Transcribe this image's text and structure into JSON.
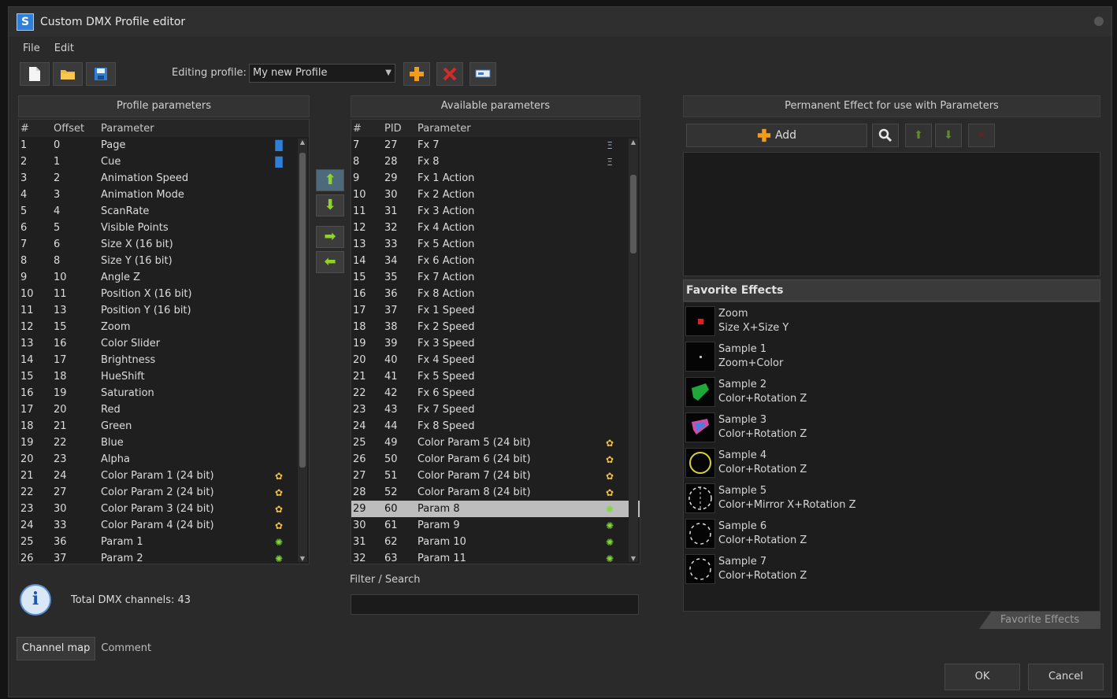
{
  "window": {
    "title": "Custom DMX Profile editor"
  },
  "menu": [
    "File",
    "Edit"
  ],
  "toolbar": {
    "editing_label": "Editing profile:",
    "profile_value": "My new Profile",
    "new_icon": "new-file-icon",
    "open_icon": "open-folder-icon",
    "save_icon": "save-disk-icon",
    "add_icon": "add-plus-icon",
    "delete_icon": "delete-x-icon",
    "rename_icon": "rename-icon"
  },
  "profile_params": {
    "title": "Profile parameters",
    "headers": [
      "#",
      "Offset",
      "Parameter"
    ],
    "rows": [
      [
        "1",
        "0",
        "Page"
      ],
      [
        "2",
        "1",
        "Cue"
      ],
      [
        "3",
        "2",
        "Animation Speed"
      ],
      [
        "4",
        "3",
        "Animation Mode"
      ],
      [
        "5",
        "4",
        "ScanRate"
      ],
      [
        "6",
        "5",
        "Visible Points"
      ],
      [
        "7",
        "6",
        "Size X (16 bit)"
      ],
      [
        "8",
        "8",
        "Size Y (16 bit)"
      ],
      [
        "9",
        "10",
        "Angle Z"
      ],
      [
        "10",
        "11",
        "Position X (16 bit)"
      ],
      [
        "11",
        "13",
        "Position Y (16 bit)"
      ],
      [
        "12",
        "15",
        "Zoom"
      ],
      [
        "13",
        "16",
        "Color Slider"
      ],
      [
        "14",
        "17",
        "Brightness"
      ],
      [
        "15",
        "18",
        "HueShift"
      ],
      [
        "16",
        "19",
        "Saturation"
      ],
      [
        "17",
        "20",
        "Red"
      ],
      [
        "18",
        "21",
        "Green"
      ],
      [
        "19",
        "22",
        "Blue"
      ],
      [
        "20",
        "23",
        "Alpha"
      ],
      [
        "21",
        "24",
        "Color Param 1 (24 bit)"
      ],
      [
        "22",
        "27",
        "Color Param 2 (24 bit)"
      ],
      [
        "23",
        "30",
        "Color Param 3 (24 bit)"
      ],
      [
        "24",
        "33",
        "Color Param 4 (24 bit)"
      ],
      [
        "25",
        "36",
        "Param 1"
      ],
      [
        "26",
        "37",
        "Param 2"
      ]
    ]
  },
  "available_params": {
    "title": "Available parameters",
    "headers": [
      "#",
      "PID",
      "Parameter"
    ],
    "rows": [
      [
        "7",
        "27",
        "Fx 7"
      ],
      [
        "8",
        "28",
        "Fx 8"
      ],
      [
        "9",
        "29",
        "Fx 1 Action"
      ],
      [
        "10",
        "30",
        "Fx 2 Action"
      ],
      [
        "11",
        "31",
        "Fx 3 Action"
      ],
      [
        "12",
        "32",
        "Fx 4 Action"
      ],
      [
        "13",
        "33",
        "Fx 5 Action"
      ],
      [
        "14",
        "34",
        "Fx 6 Action"
      ],
      [
        "15",
        "35",
        "Fx 7 Action"
      ],
      [
        "16",
        "36",
        "Fx 8 Action"
      ],
      [
        "17",
        "37",
        "Fx 1 Speed"
      ],
      [
        "18",
        "38",
        "Fx 2 Speed"
      ],
      [
        "19",
        "39",
        "Fx 3 Speed"
      ],
      [
        "20",
        "40",
        "Fx 4 Speed"
      ],
      [
        "21",
        "41",
        "Fx 5 Speed"
      ],
      [
        "22",
        "42",
        "Fx 6 Speed"
      ],
      [
        "23",
        "43",
        "Fx 7 Speed"
      ],
      [
        "24",
        "44",
        "Fx 8 Speed"
      ],
      [
        "25",
        "49",
        "Color Param 5 (24 bit)"
      ],
      [
        "26",
        "50",
        "Color Param 6 (24 bit)"
      ],
      [
        "27",
        "51",
        "Color Param 7 (24 bit)"
      ],
      [
        "28",
        "52",
        "Color Param 8 (24 bit)"
      ],
      [
        "29",
        "60",
        "Param 8"
      ],
      [
        "30",
        "61",
        "Param 9"
      ],
      [
        "31",
        "62",
        "Param 10"
      ],
      [
        "32",
        "63",
        "Param 11"
      ]
    ],
    "selected_row": "29"
  },
  "filter": {
    "label": "Filter / Search",
    "value": ""
  },
  "info": {
    "total": "Total DMX channels: 43"
  },
  "tabs": [
    "Channel map",
    "Comment"
  ],
  "permanent": {
    "title": "Permanent Effect for use with Parameters",
    "add_label": "Add"
  },
  "favorites": {
    "title": "Favorite Effects",
    "tab_label": "Favorite Effects",
    "items": [
      {
        "name": "Zoom",
        "desc": "Size X+Size Y"
      },
      {
        "name": "Sample 1",
        "desc": "Zoom+Color"
      },
      {
        "name": "Sample 2",
        "desc": "Color+Rotation Z"
      },
      {
        "name": "Sample 3",
        "desc": "Color+Rotation Z"
      },
      {
        "name": "Sample 4",
        "desc": "Color+Rotation Z"
      },
      {
        "name": "Sample 5",
        "desc": "Color+Mirror X+Rotation Z"
      },
      {
        "name": "Sample 6",
        "desc": "Color+Rotation Z"
      },
      {
        "name": "Sample 7",
        "desc": "Color+Rotation Z"
      }
    ]
  },
  "buttons": {
    "ok": "OK",
    "cancel": "Cancel"
  },
  "colors": {
    "accent_green": "#8ed22c",
    "accent_orange": "#f29b1d",
    "danger_red": "#d22b2b",
    "accent_blue": "#2f7fd8"
  }
}
